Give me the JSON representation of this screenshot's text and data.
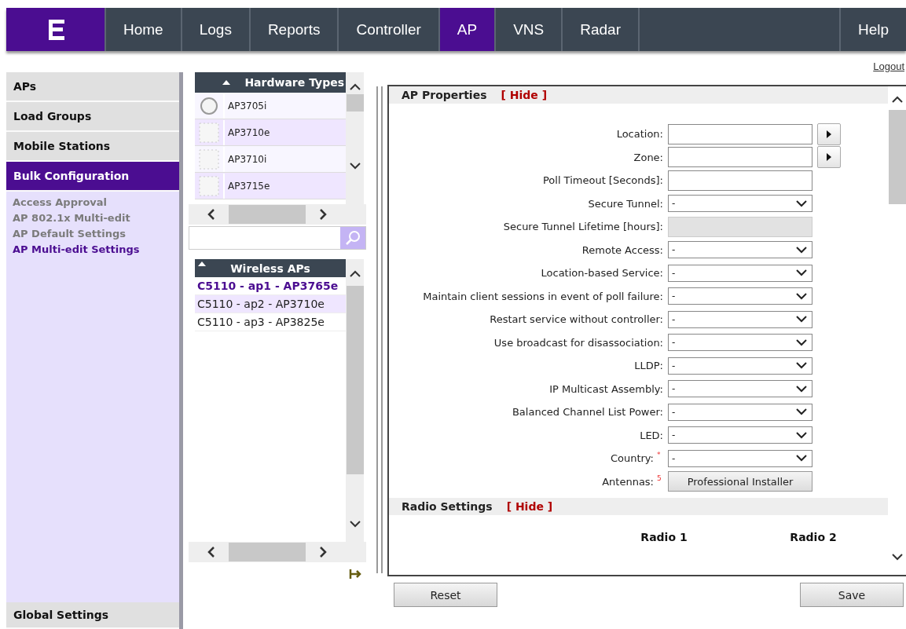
{
  "nav": {
    "tabs": [
      {
        "label": "Home",
        "selected": false
      },
      {
        "label": "Logs",
        "selected": false
      },
      {
        "label": "Reports",
        "selected": false
      },
      {
        "label": "Controller",
        "selected": false
      },
      {
        "label": "AP",
        "selected": true
      },
      {
        "label": "VNS",
        "selected": false
      },
      {
        "label": "Radar",
        "selected": false
      }
    ],
    "help": "Help"
  },
  "logout": "Logout",
  "sidebar": {
    "sections": [
      {
        "label": "APs",
        "selected": false
      },
      {
        "label": "Load Groups",
        "selected": false
      },
      {
        "label": "Mobile Stations",
        "selected": false
      },
      {
        "label": "Bulk Configuration",
        "selected": true
      }
    ],
    "items": [
      {
        "label": "Access Approval",
        "selected": false
      },
      {
        "label": "AP 802.1x Multi-edit",
        "selected": false
      },
      {
        "label": "AP Default Settings",
        "selected": false
      },
      {
        "label": "AP Multi-edit Settings",
        "selected": true
      }
    ],
    "bottom": "Global Settings"
  },
  "hardware_types": {
    "header": "Hardware Types",
    "rows": [
      {
        "label": "AP3705i",
        "kind": "round"
      },
      {
        "label": "AP3710e",
        "kind": "square"
      },
      {
        "label": "AP3710i",
        "kind": "square"
      },
      {
        "label": "AP3715e",
        "kind": "square"
      }
    ]
  },
  "wireless_aps": {
    "header": "Wireless APs",
    "rows": [
      {
        "label": "C5110 - ap1 - AP3765e",
        "selected": true
      },
      {
        "label": "C5110 - ap2 - AP3710e",
        "selected": false
      },
      {
        "label": "C5110 - ap3 - AP3825e",
        "selected": false
      }
    ]
  },
  "ap_properties": {
    "title": "AP Properties",
    "hide": "[ Hide ]",
    "fields": [
      {
        "label": "Location:",
        "kind": "picker"
      },
      {
        "label": "Zone:",
        "kind": "picker"
      },
      {
        "label": "Poll Timeout [Seconds]:",
        "kind": "text"
      },
      {
        "label": "Secure Tunnel:",
        "kind": "select",
        "value": "-"
      },
      {
        "label": "Secure Tunnel Lifetime [hours]:",
        "kind": "disabled"
      },
      {
        "label": "Remote Access:",
        "kind": "select",
        "value": "-"
      },
      {
        "label": "Location-based Service:",
        "kind": "select",
        "value": "-"
      },
      {
        "label": "Maintain client sessions in event of poll failure:",
        "kind": "select",
        "value": "-"
      },
      {
        "label": "Restart service without controller:",
        "kind": "select",
        "value": "-"
      },
      {
        "label": "Use broadcast for disassociation:",
        "kind": "select",
        "value": "-"
      },
      {
        "label": "LLDP:",
        "kind": "select",
        "value": "-"
      },
      {
        "label": "IP Multicast Assembly:",
        "kind": "select",
        "value": "-"
      },
      {
        "label": "Balanced Channel List Power:",
        "kind": "select",
        "value": "-"
      },
      {
        "label": "LED:",
        "kind": "select",
        "value": "-"
      },
      {
        "label": "Country:",
        "kind": "select",
        "value": "-",
        "note": "*"
      },
      {
        "label": "Antennas:",
        "kind": "button",
        "value": "Professional Installer",
        "note": "5"
      }
    ]
  },
  "radio_settings": {
    "title": "Radio Settings",
    "hide": "[ Hide ]",
    "columns": [
      "Radio 1",
      "Radio 2"
    ]
  },
  "buttons": {
    "reset": "Reset",
    "save": "Save"
  }
}
